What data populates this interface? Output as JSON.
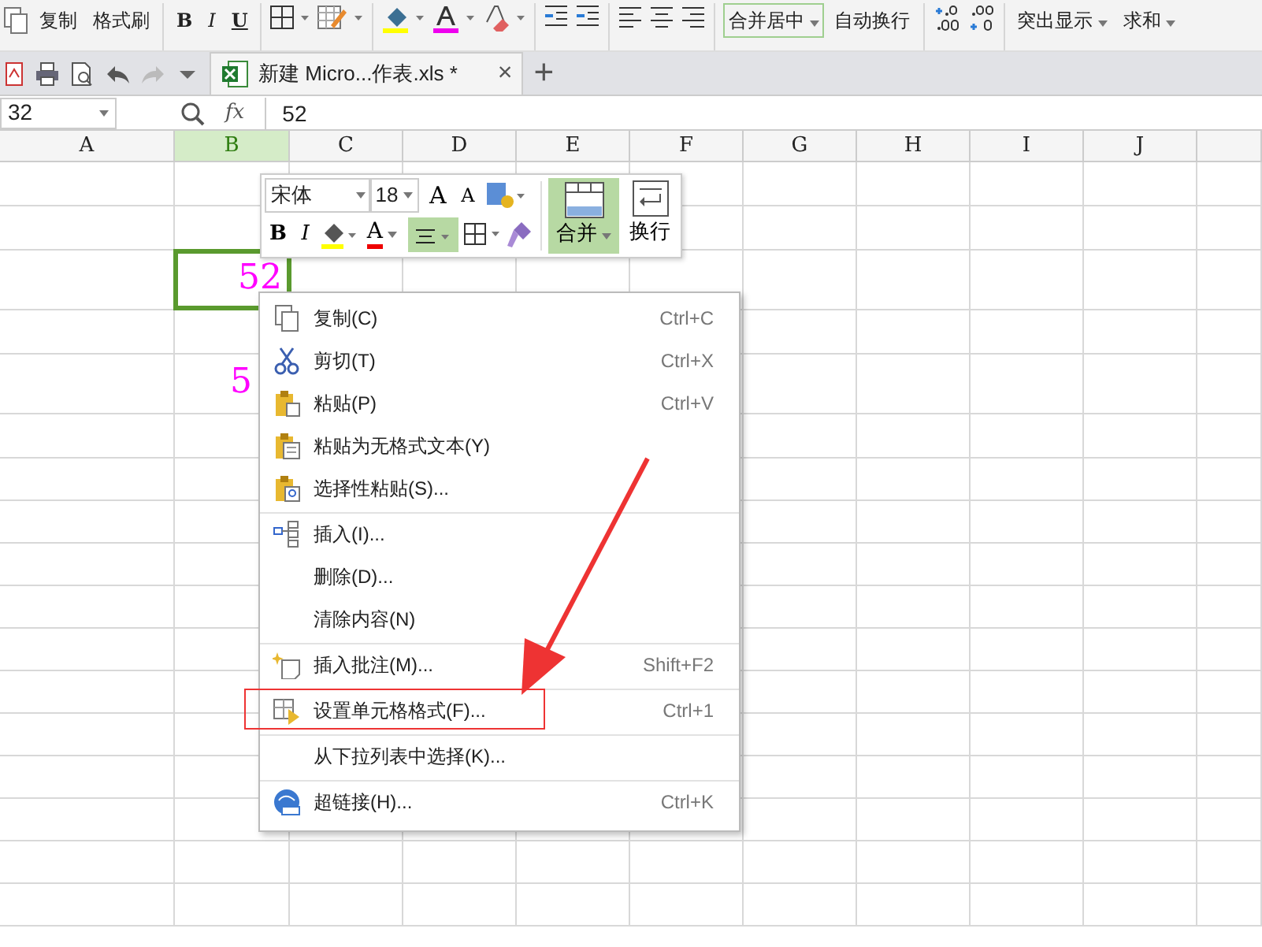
{
  "ribbon": {
    "copy": "复制",
    "format_painter": "格式刷",
    "bold": "B",
    "italic": "I",
    "underline": "U",
    "merge_center": {
      "label": "合并居中",
      "highlighted": true
    },
    "wrap_text": "自动换行",
    "highlight": "突出显示",
    "sum": "求和"
  },
  "tabs": [
    {
      "label": "新建 Micro...作表.xls *",
      "close": "×",
      "selected": true
    }
  ],
  "new_tab": "+",
  "formula_bar": {
    "name_box": "32",
    "fx": "fx",
    "value": "52"
  },
  "columns": [
    {
      "label": "A",
      "selected": false
    },
    {
      "label": "B",
      "selected": true
    },
    {
      "label": "C",
      "selected": false
    },
    {
      "label": "D",
      "selected": false
    },
    {
      "label": "E",
      "selected": false
    },
    {
      "label": "F",
      "selected": false
    },
    {
      "label": "G",
      "selected": false
    },
    {
      "label": "H",
      "selected": false
    },
    {
      "label": "I",
      "selected": false
    },
    {
      "label": "J",
      "selected": false
    }
  ],
  "cells": [
    {
      "value": "52",
      "selected": true
    },
    {
      "value": "5",
      "selected": false
    }
  ],
  "mini_toolbar": {
    "font": "宋体",
    "size": "18",
    "grow": "A",
    "shrink": "A",
    "bold": "B",
    "italic": "I",
    "font_color": "A",
    "align_active": true,
    "merge": {
      "label": "合并",
      "highlighted": true
    },
    "wrap": "换行"
  },
  "context_menu": [
    {
      "label": "复制(C)",
      "shortcut": "Ctrl+C",
      "separator_before": false,
      "annotated": false
    },
    {
      "label": "剪切(T)",
      "shortcut": "Ctrl+X",
      "separator_before": false,
      "annotated": false
    },
    {
      "label": "粘贴(P)",
      "shortcut": "Ctrl+V",
      "separator_before": false,
      "annotated": false
    },
    {
      "label": "粘贴为无格式文本(Y)",
      "separator_before": false,
      "annotated": false
    },
    {
      "label": "选择性粘贴(S)...",
      "separator_before": false,
      "annotated": false
    },
    {
      "label": "插入(I)...",
      "separator_before": true,
      "annotated": false
    },
    {
      "label": "删除(D)...",
      "separator_before": false,
      "annotated": false
    },
    {
      "label": "清除内容(N)",
      "separator_before": false,
      "annotated": false
    },
    {
      "label": "插入批注(M)...",
      "shortcut": "Shift+F2",
      "separator_before": true,
      "annotated": false
    },
    {
      "label": "设置单元格格式(F)...",
      "shortcut": "Ctrl+1",
      "separator_before": true,
      "annotated": true
    },
    {
      "label": "从下拉列表中选择(K)...",
      "separator_before": true,
      "annotated": false
    },
    {
      "label": "超链接(H)...",
      "shortcut": "Ctrl+K",
      "separator_before": true,
      "annotated": false
    }
  ]
}
